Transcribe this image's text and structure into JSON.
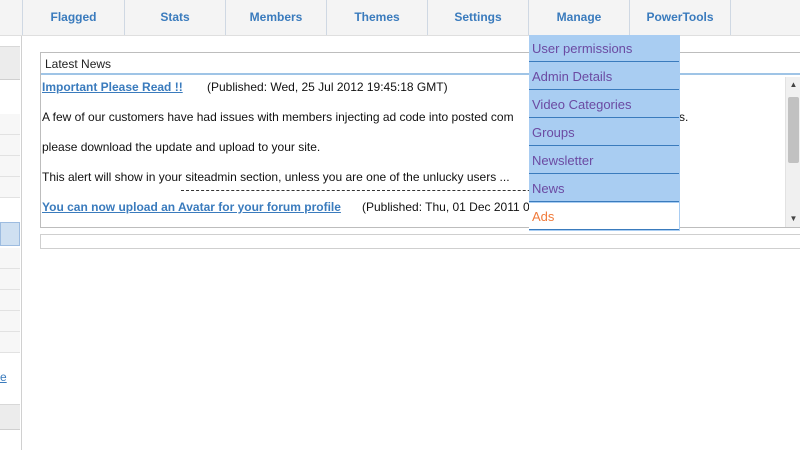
{
  "nav": {
    "items": [
      "Flagged",
      "Stats",
      "Members",
      "Themes",
      "Settings",
      "Manage",
      "PowerTools"
    ]
  },
  "manage_menu": {
    "items": [
      "User permissions",
      "Admin Details",
      "Video Categories",
      "Groups",
      "Newsletter",
      "News",
      "Ads"
    ]
  },
  "news": {
    "header": "Latest News",
    "items": [
      {
        "title": "Important Please Read !!",
        "published": "(Published: Wed, 25 Jul 2012 19:45:18 GMT)",
        "lines": [
          "A few of our customers have had issues with members injecting ad code into posted com",
          "please download the update and upload to your site.",
          "This alert will show in your siteadmin section, unless you are one of the unlucky users ..."
        ],
        "line_tail": "s."
      },
      {
        "title": "You can now upload an Avatar for your forum profile",
        "published": "(Published: Thu, 01 Dec 2011 0"
      }
    ]
  },
  "sidebar": {
    "link_fragment": "e"
  },
  "scrollbar": {
    "up_glyph": "▲",
    "down_glyph": "▼"
  },
  "colors": {
    "nav_text": "#3a7bbd",
    "dropdown_bg": "#a9cdf2",
    "dropdown_text": "#6b4aa2",
    "ads_text": "#f07a3a"
  }
}
